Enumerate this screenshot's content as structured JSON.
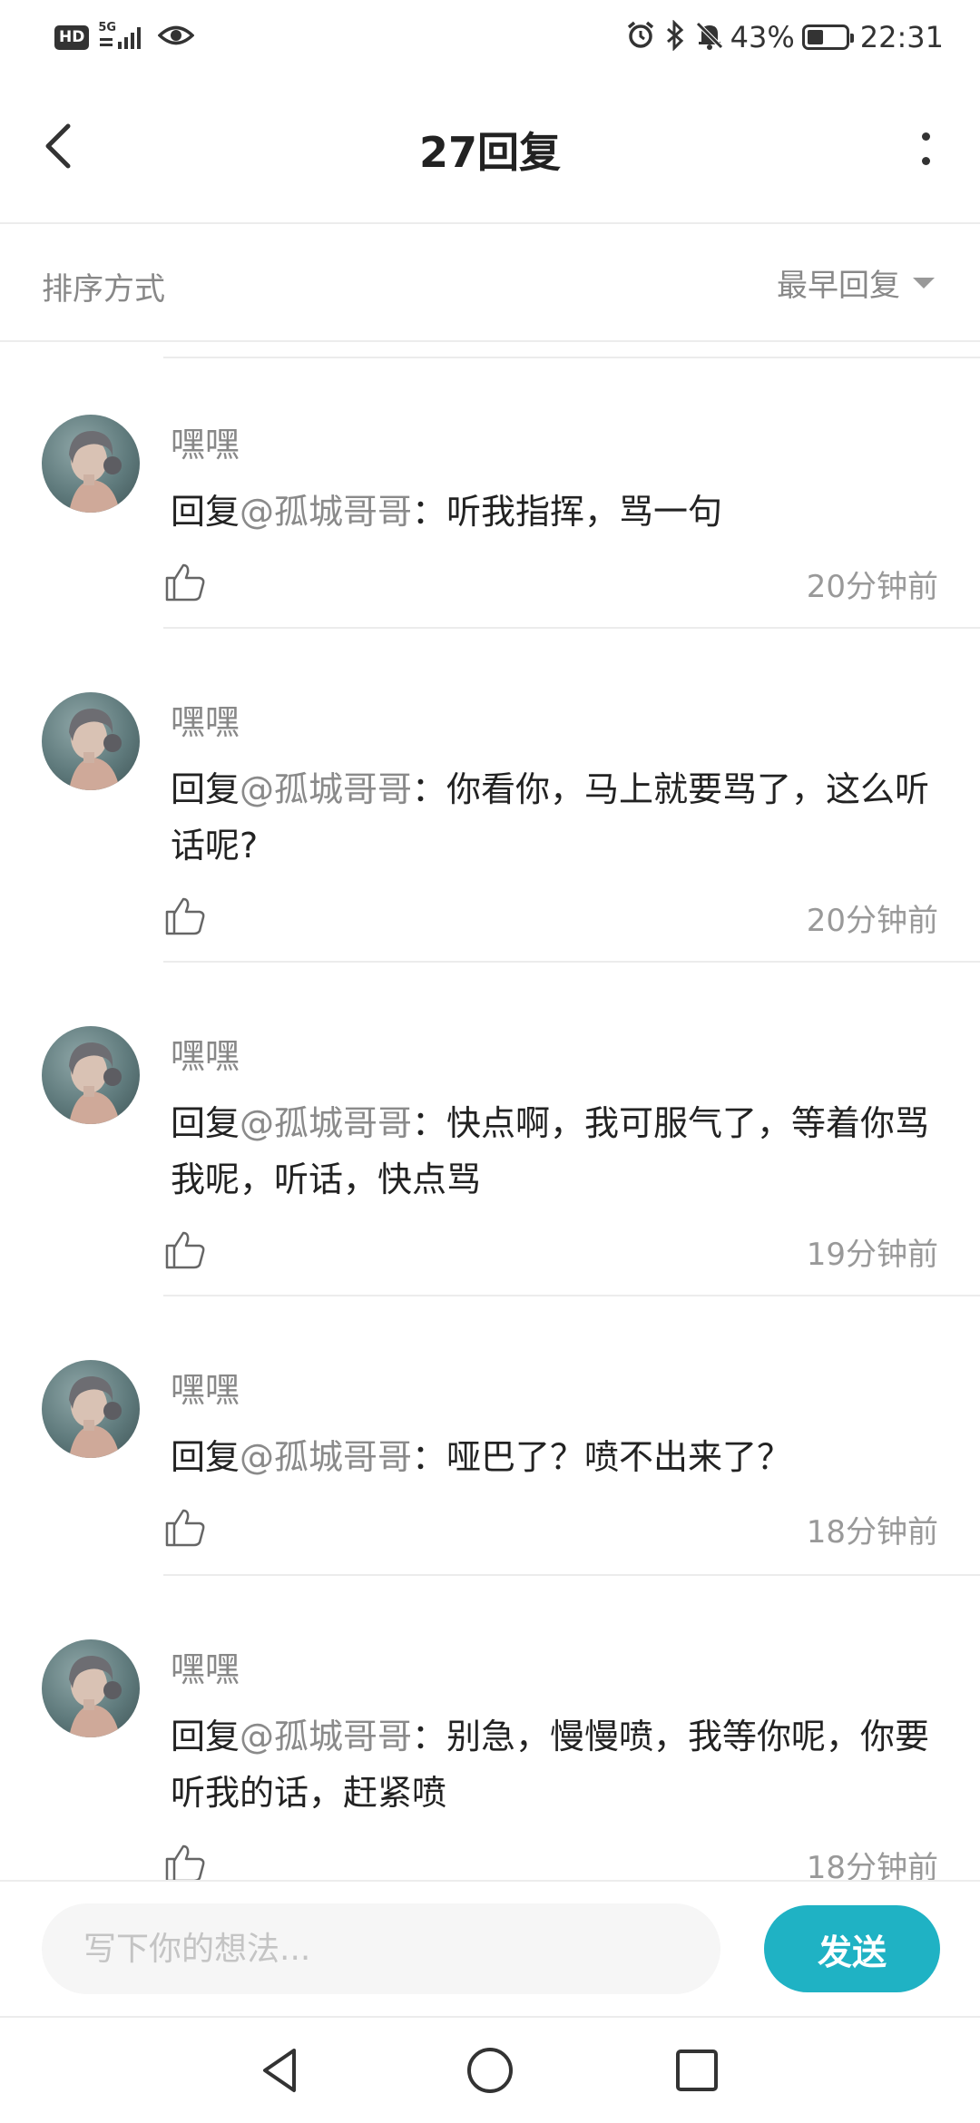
{
  "status_bar": {
    "hd_badge": "HD",
    "network": "5G",
    "battery_text": "43%",
    "battery_level": 0.43,
    "time": "22:31"
  },
  "header": {
    "title": "27回复"
  },
  "sort": {
    "label": "排序方式",
    "value": "最早回复"
  },
  "comments": [
    {
      "name": "嘿嘿",
      "prefix": "回复",
      "mention": "@孤城哥哥",
      "text": "：听我指挥，骂一句",
      "time": "20分钟前"
    },
    {
      "name": "嘿嘿",
      "prefix": "回复",
      "mention": "@孤城哥哥",
      "text": "：你看你，马上就要骂了，这么听话呢?",
      "time": "20分钟前"
    },
    {
      "name": "嘿嘿",
      "prefix": "回复",
      "mention": "@孤城哥哥",
      "text": "：快点啊，我可服气了，等着你骂我呢，听话，快点骂",
      "time": "19分钟前"
    },
    {
      "name": "嘿嘿",
      "prefix": "回复",
      "mention": "@孤城哥哥",
      "text": "：哑巴了？喷不出来了？",
      "time": "18分钟前"
    },
    {
      "name": "嘿嘿",
      "prefix": "回复",
      "mention": "@孤城哥哥",
      "text": "：别急，慢慢喷，我等你呢，你要听我的话，赶紧喷",
      "time": "18分钟前"
    }
  ],
  "input": {
    "placeholder": "写下你的想法..."
  },
  "send_label": "发送",
  "colors": {
    "accent": "#1fb2c4",
    "mention": "#8a8a8a",
    "meta": "#999999"
  },
  "icons": [
    "back-arrow-icon",
    "more-vertical-icon",
    "caret-down-icon",
    "thumbs-up-icon",
    "nav-back-icon",
    "nav-home-icon",
    "nav-recents-icon"
  ]
}
